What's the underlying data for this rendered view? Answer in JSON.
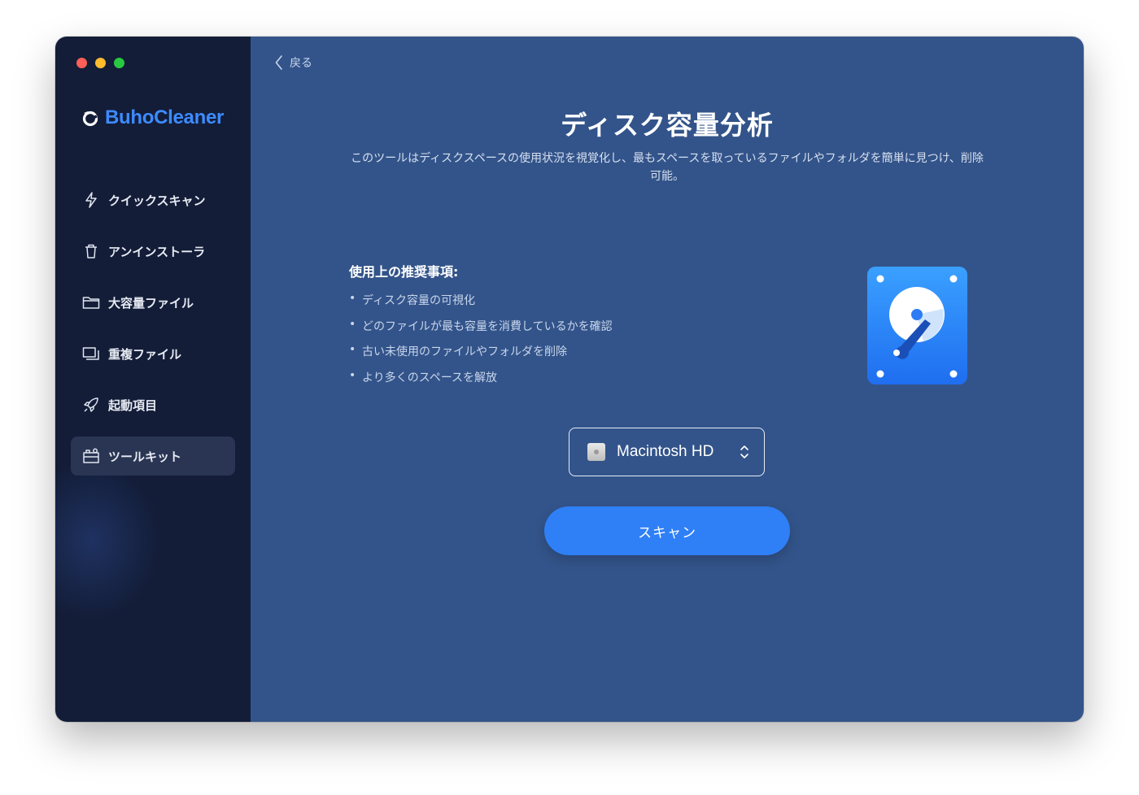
{
  "app": {
    "name": "BuhoCleaner"
  },
  "window_controls": [
    "close",
    "minimize",
    "zoom"
  ],
  "sidebar": {
    "items": [
      {
        "label": "クイックスキャン",
        "icon": "lightning-icon",
        "active": false
      },
      {
        "label": "アンインストーラ",
        "icon": "trash-icon",
        "active": false
      },
      {
        "label": "大容量ファイル",
        "icon": "folder-icon",
        "active": false
      },
      {
        "label": "重複ファイル",
        "icon": "duplicate-icon",
        "active": false
      },
      {
        "label": "起動項目",
        "icon": "rocket-icon",
        "active": false
      },
      {
        "label": "ツールキット",
        "icon": "toolkit-icon",
        "active": true
      }
    ]
  },
  "main": {
    "back_label": "戻る",
    "title": "ディスク容量分析",
    "description": "このツールはディスクスペースの使用状況を視覚化し、最もスペースを取っているファイルやフォルダを簡単に見つけ、削除可能。",
    "tips_heading": "使用上の推奨事項:",
    "tips": [
      "ディスク容量の可視化",
      "どのファイルが最も容量を消費しているかを確認",
      "古い未使用のファイルやフォルダを削除",
      "より多くのスペースを解放"
    ],
    "disk_select": {
      "value": "Macintosh HD"
    },
    "scan_label": "スキャン"
  },
  "colors": {
    "sidebar_bg": "#131d38",
    "main_bg": "#33548a",
    "accent": "#2f80f7",
    "logo": "#3d8bff"
  }
}
